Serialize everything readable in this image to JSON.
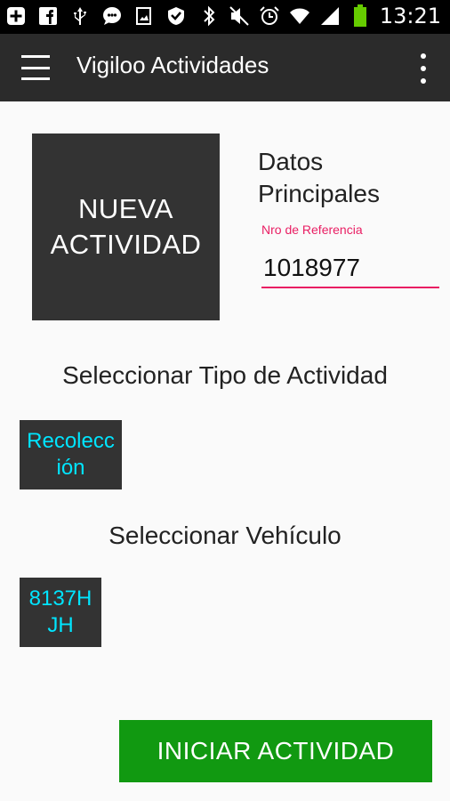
{
  "status_bar": {
    "time": "13:21",
    "left_icons": [
      "add-box-icon",
      "facebook-icon",
      "usb-icon",
      "chat-icon",
      "image-icon",
      "check-badge-icon"
    ],
    "right_icons": [
      "bluetooth-icon",
      "mute-icon",
      "alarm-icon",
      "wifi-icon",
      "signal-icon",
      "battery-icon"
    ]
  },
  "app_bar": {
    "title": "Vigiloo Actividades",
    "menu_icon": "hamburger-menu-icon",
    "overflow_icon": "overflow-menu-icon"
  },
  "main": {
    "nueva_actividad_label": "NUEVA ACTIVIDAD",
    "datos_title": "Datos Principales",
    "ref_label": "Nro de Referencia",
    "ref_value": "1018977",
    "tipo_title": "Seleccionar Tipo de Actividad",
    "tipo_option": "Recolección",
    "vehiculo_title": "Seleccionar Vehículo",
    "vehiculo_option": "8137HJH",
    "iniciar_label": "INICIAR ACTIVIDAD"
  },
  "colors": {
    "accent": "#e91e63",
    "tile_text": "#00e5ff",
    "primary_button": "#119911",
    "app_bar": "#2b2b2b"
  }
}
